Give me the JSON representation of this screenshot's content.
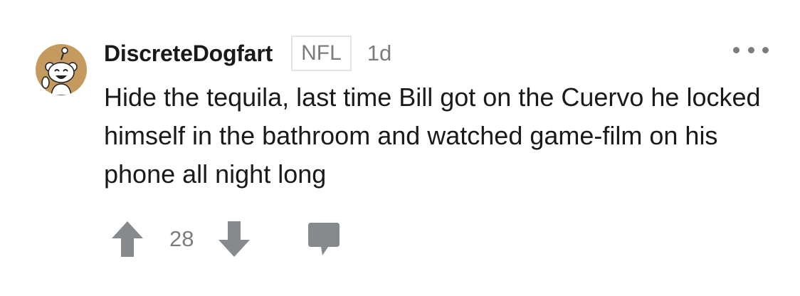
{
  "comment": {
    "username": "DiscreteDogfart",
    "flair": "NFL",
    "age": "1d",
    "body": "Hide the tequila, last time Bill got on the Cuervo he locked himself in the bathroom and watched game-film on his phone all night long",
    "score": "28"
  },
  "icons": {
    "avatar": "snoo-avatar-icon",
    "more": "more-options-icon",
    "upvote": "upvote-arrow-icon",
    "downvote": "downvote-arrow-icon",
    "reply": "comment-bubble-icon"
  },
  "colors": {
    "text": "#1a1a1b",
    "meta": "#7c7c7c",
    "avatar_bg": "#c49a5e",
    "flair_border": "#e3e3e3"
  }
}
